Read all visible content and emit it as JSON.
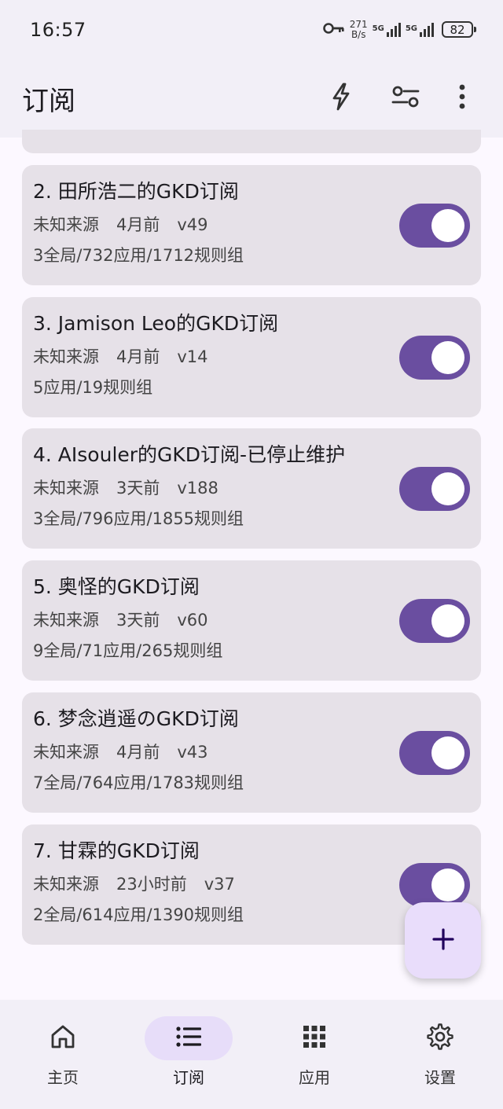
{
  "status_bar": {
    "time": "16:57",
    "net_speed_value": "271",
    "net_speed_unit": "B/s",
    "sim1_label": "5G",
    "sim2_label": "5G",
    "battery": "82"
  },
  "app_bar": {
    "title": "订阅",
    "actions": [
      "flash-icon",
      "filter-settings-icon",
      "more-vert-icon"
    ]
  },
  "subscriptions": [
    {
      "title": "2. 田所浩二的GKD订阅",
      "source": "未知来源",
      "updated": "4月前",
      "version": "v49",
      "stats": "3全局/732应用/1712规则组",
      "enabled": true
    },
    {
      "title": "3. Jamison Leo的GKD订阅",
      "source": "未知来源",
      "updated": "4月前",
      "version": "v14",
      "stats": "5应用/19规则组",
      "enabled": true
    },
    {
      "title": "4. AIsouler的GKD订阅-已停止维护",
      "source": "未知来源",
      "updated": "3天前",
      "version": "v188",
      "stats": "3全局/796应用/1855规则组",
      "enabled": true
    },
    {
      "title": "5. 奥怪的GKD订阅",
      "source": "未知来源",
      "updated": "3天前",
      "version": "v60",
      "stats": "9全局/71应用/265规则组",
      "enabled": true
    },
    {
      "title": "6. 梦念逍遥のGKD订阅",
      "source": "未知来源",
      "updated": "4月前",
      "version": "v43",
      "stats": "7全局/764应用/1783规则组",
      "enabled": true
    },
    {
      "title": "7. 甘霖的GKD订阅",
      "source": "未知来源",
      "updated": "23小时前",
      "version": "v37",
      "stats": "2全局/614应用/1390规则组",
      "enabled": true
    }
  ],
  "fab": {
    "icon": "add-icon"
  },
  "bottom_nav": {
    "items": [
      {
        "label": "主页",
        "icon": "home-icon",
        "active": false
      },
      {
        "label": "订阅",
        "icon": "list-icon",
        "active": true
      },
      {
        "label": "应用",
        "icon": "apps-grid-icon",
        "active": false
      },
      {
        "label": "设置",
        "icon": "settings-gear-icon",
        "active": false
      }
    ]
  },
  "colors": {
    "primary": "#6a4ea0",
    "surface": "#fcf8ff",
    "card": "#e6e1e8",
    "bar": "#f2eff7",
    "fab": "#e9ddfb",
    "nav_active_pill": "#e7ddf9"
  }
}
